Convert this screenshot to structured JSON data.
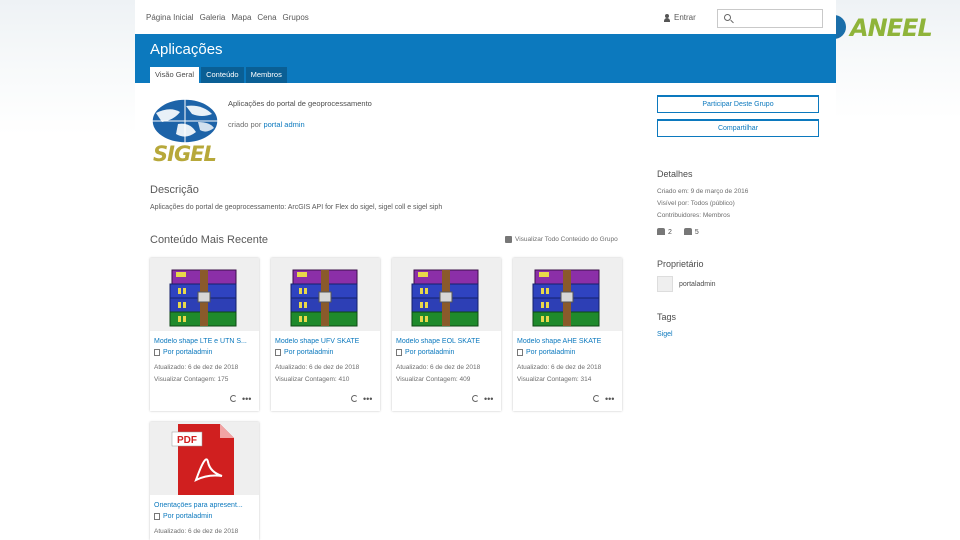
{
  "topnav": {
    "links": [
      "Página Inicial",
      "Galeria",
      "Mapa",
      "Cena",
      "Grupos"
    ],
    "signin": "Entrar",
    "search_placeholder": ""
  },
  "banner": {
    "title": "Aplicações",
    "tabs": [
      "Visão Geral",
      "Conteúdo",
      "Membros"
    ],
    "active_tab": 0
  },
  "group": {
    "logo_text": "SIGEL",
    "title": "Aplicações do portal de geoprocessamento",
    "created_prefix": "criado por",
    "created_by": "portal admin"
  },
  "description": {
    "heading": "Descrição",
    "text": "Aplicações do portal de geoprocessamento: ArcGIS API for Flex do sigel, sigel coll e sigel siph"
  },
  "recent": {
    "heading": "Conteúdo Mais Recente",
    "view_all": "Visualizar Todo Conteúdo do Grupo",
    "items": [
      {
        "title": "Modelo shape LTE e UTN S...",
        "owner": "Por portaladmin",
        "updated": "Atualizado: 6 de dez de 2018",
        "views": "Visualizar Contagem: 175",
        "thumb": "winrar"
      },
      {
        "title": "Modelo shape UFV SKATE",
        "owner": "Por portaladmin",
        "updated": "Atualizado: 6 de dez de 2018",
        "views": "Visualizar Contagem: 410",
        "thumb": "winrar"
      },
      {
        "title": "Modelo shape EOL SKATE",
        "owner": "Por portaladmin",
        "updated": "Atualizado: 6 de dez de 2018",
        "views": "Visualizar Contagem: 409",
        "thumb": "winrar"
      },
      {
        "title": "Modelo shape AHE SKATE",
        "owner": "Por portaladmin",
        "updated": "Atualizado: 6 de dez de 2018",
        "views": "Visualizar Contagem: 314",
        "thumb": "winrar"
      },
      {
        "title": "Orientações para apresent...",
        "owner": "Por portaladmin",
        "updated": "Atualizado: 6 de dez de 2018",
        "views": "",
        "thumb": "pdf",
        "thumb_label": "PDF"
      }
    ]
  },
  "sidebar": {
    "join_button": "Participar Deste Grupo",
    "share_button": "Compartilhar",
    "details_heading": "Detalhes",
    "created": "Criado em: 9 de março de 2016",
    "visible": "Visível por: Todos (público)",
    "contributors": "Contribuidores: Membros",
    "members_count": "2",
    "items_count": "5",
    "owner_heading": "Proprietário",
    "owner_name": "portaladmin",
    "tags_heading": "Tags",
    "tag": "Sigel"
  },
  "brand": {
    "name": "ANEEL"
  },
  "colors": {
    "accent": "#0c79be",
    "tab_inactive": "#0a5f95",
    "sigel_gold": "#b7a83a",
    "aneel_green": "#8fb43a"
  }
}
